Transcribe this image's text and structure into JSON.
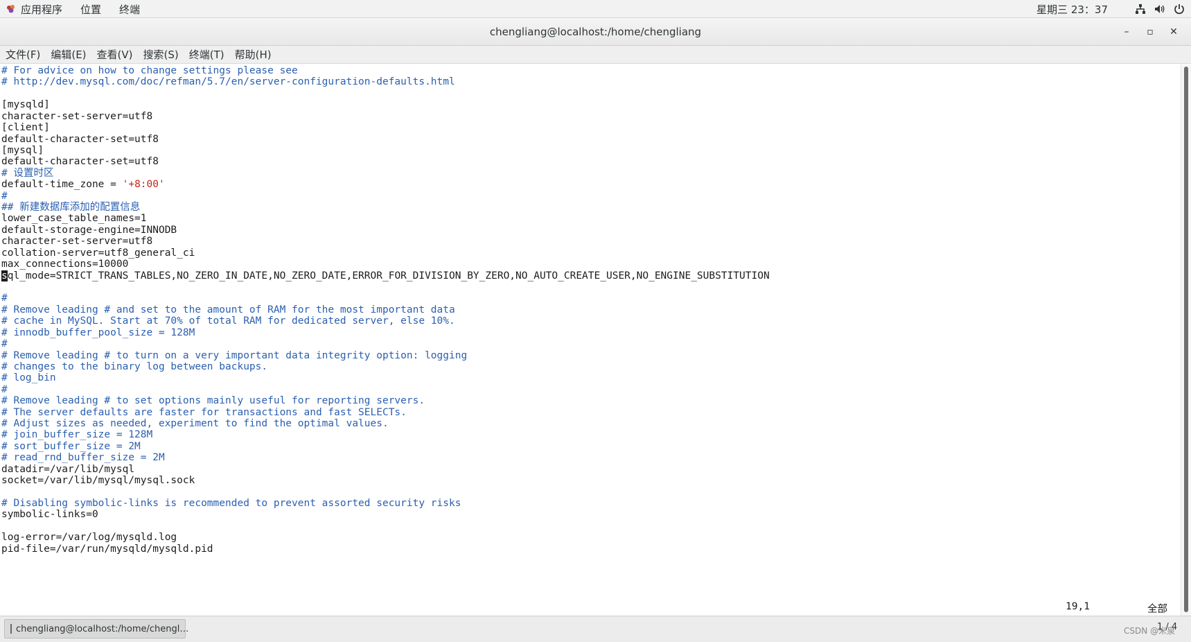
{
  "topbar": {
    "applications": "应用程序",
    "places": "位置",
    "terminal": "终端",
    "clock": "星期三 23：37"
  },
  "window": {
    "title": "chengliang@localhost:/home/chengliang",
    "minimize": "–",
    "maximize": "▫",
    "close": "✕"
  },
  "menubar": [
    "文件(F)",
    "编辑(E)",
    "查看(V)",
    "搜索(S)",
    "终端(T)",
    "帮助(H)"
  ],
  "terminal": {
    "lines": [
      {
        "text": "# For advice on how to change settings please see",
        "type": "comment"
      },
      {
        "text": "# http://dev.mysql.com/doc/refman/5.7/en/server-configuration-defaults.html",
        "type": "comment"
      },
      {
        "text": "",
        "type": "text"
      },
      {
        "text": "[mysqld]",
        "type": "text"
      },
      {
        "text": "character-set-server=utf8",
        "type": "text"
      },
      {
        "text": "[client]",
        "type": "text"
      },
      {
        "text": "default-character-set=utf8",
        "type": "text"
      },
      {
        "text": "[mysql]",
        "type": "text"
      },
      {
        "text": "default-character-set=utf8",
        "type": "text"
      },
      {
        "text": "# 设置时区",
        "type": "comment"
      },
      {
        "text": "default-time_zone = ",
        "type": "text",
        "str": "'+8:00'"
      },
      {
        "text": "#",
        "type": "comment"
      },
      {
        "text": "## 新建数据库添加的配置信息",
        "type": "comment"
      },
      {
        "text": "lower_case_table_names=1",
        "type": "text"
      },
      {
        "text": "default-storage-engine=INNODB",
        "type": "text"
      },
      {
        "text": "character-set-server=utf8",
        "type": "text"
      },
      {
        "text": "collation-server=utf8_general_ci",
        "type": "text"
      },
      {
        "text": "max_connections=10000",
        "type": "text"
      },
      {
        "text": "sql_mode=STRICT_TRANS_TABLES,NO_ZERO_IN_DATE,NO_ZERO_DATE,ERROR_FOR_DIVISION_BY_ZERO,NO_AUTO_CREATE_USER,NO_ENGINE_SUBSTITUTION",
        "type": "text",
        "cursor": true
      },
      {
        "text": "",
        "type": "text"
      },
      {
        "text": "#",
        "type": "comment"
      },
      {
        "text": "# Remove leading # and set to the amount of RAM for the most important data",
        "type": "comment"
      },
      {
        "text": "# cache in MySQL. Start at 70% of total RAM for dedicated server, else 10%.",
        "type": "comment"
      },
      {
        "text": "# innodb_buffer_pool_size = 128M",
        "type": "comment"
      },
      {
        "text": "#",
        "type": "comment"
      },
      {
        "text": "# Remove leading # to turn on a very important data integrity option: logging",
        "type": "comment"
      },
      {
        "text": "# changes to the binary log between backups.",
        "type": "comment"
      },
      {
        "text": "# log_bin",
        "type": "comment"
      },
      {
        "text": "#",
        "type": "comment"
      },
      {
        "text": "# Remove leading # to set options mainly useful for reporting servers.",
        "type": "comment"
      },
      {
        "text": "# The server defaults are faster for transactions and fast SELECTs.",
        "type": "comment"
      },
      {
        "text": "# Adjust sizes as needed, experiment to find the optimal values.",
        "type": "comment"
      },
      {
        "text": "# join_buffer_size = 128M",
        "type": "comment"
      },
      {
        "text": "# sort_buffer_size = 2M",
        "type": "comment"
      },
      {
        "text": "# read_rnd_buffer_size = 2M",
        "type": "comment"
      },
      {
        "text": "datadir=/var/lib/mysql",
        "type": "text"
      },
      {
        "text": "socket=/var/lib/mysql/mysql.sock",
        "type": "text"
      },
      {
        "text": "",
        "type": "text"
      },
      {
        "text": "# Disabling symbolic-links is recommended to prevent assorted security risks",
        "type": "comment"
      },
      {
        "text": "symbolic-links=0",
        "type": "text"
      },
      {
        "text": "",
        "type": "text"
      },
      {
        "text": "log-error=/var/log/mysqld.log",
        "type": "text"
      },
      {
        "text": "pid-file=/var/run/mysqld/mysqld.pid",
        "type": "text"
      }
    ],
    "status_position": "19,1",
    "status_all": "全部"
  },
  "taskbar": {
    "item_label": "chengliang@localhost:/home/chengl…",
    "pager": "1 / 4",
    "watermark": "CSDN @米泉"
  },
  "colors": {
    "comment": "#2a5fb0",
    "string": "#c4231b",
    "text": "#1c1c1c"
  },
  "icons": {
    "applications": "apps-icon",
    "network": "network-icon",
    "volume": "volume-icon",
    "power": "power-icon",
    "terminal": "terminal-icon"
  }
}
